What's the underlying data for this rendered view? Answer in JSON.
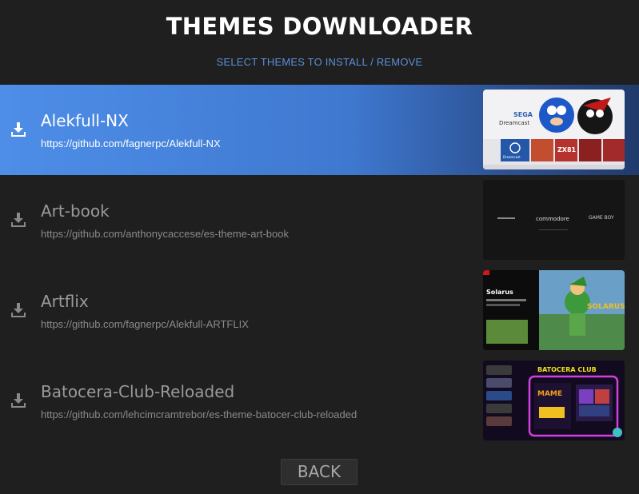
{
  "header": {
    "title": "THEMES DOWNLOADER",
    "subtitle": "SELECT THEMES TO INSTALL / REMOVE"
  },
  "themes": [
    {
      "name": "Alekfull-NX",
      "url": "https://github.com/fagnerpc/Alekfull-NX",
      "selected": true
    },
    {
      "name": "Art-book",
      "url": "https://github.com/anthonycaccese/es-theme-art-book",
      "selected": false
    },
    {
      "name": "Artflix",
      "url": "https://github.com/fagnerpc/Alekfull-ARTFLIX",
      "selected": false
    },
    {
      "name": "Batocera-Club-Reloaded",
      "url": "https://github.com/lehcimcramtrebor/es-theme-batocer-club-reloaded",
      "selected": false
    }
  ],
  "previews": {
    "alekfull": {
      "logo_main": "SEGA",
      "logo_sub": "Dreamcast",
      "tile_1": "Dreamcast",
      "tile_2": "ZX81"
    },
    "artbook": {
      "logo_1": "commodore",
      "logo_2": "GAME BOY"
    },
    "artflix": {
      "heading": "Solarus",
      "logo": "SOLARUS"
    },
    "batocera": {
      "banner": "BATOCERA CLUB",
      "system": "MAME"
    }
  },
  "footer": {
    "back_label": "BACK"
  },
  "colors": {
    "background": "#1f1f1f",
    "selected_start": "#4e8ee8",
    "selected_end": "#203a6a",
    "subtitle": "#5b8fd8"
  },
  "icons": {
    "row_icon": "download-icon"
  }
}
